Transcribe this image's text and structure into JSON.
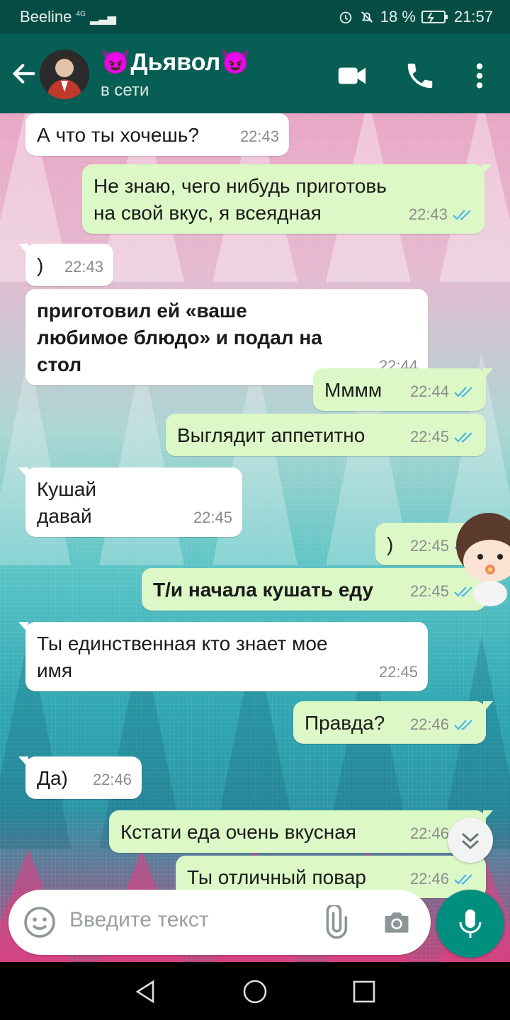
{
  "status_bar": {
    "carrier": "Beeline",
    "network": "4G",
    "battery": "18 %",
    "time": "21:57"
  },
  "header": {
    "name_emoji": "😈",
    "name": "Дьявол",
    "status": "в сети",
    "icons": [
      "back-arrow-icon",
      "video-call-icon",
      "voice-call-icon",
      "more-vert-icon"
    ]
  },
  "messages": [
    {
      "dir": "in",
      "text": "А что ты хочешь?",
      "time": "22:43",
      "tail": false
    },
    {
      "dir": "out",
      "text": "Не знаю, чего нибудь приготовь на свой вкус, я всеядная",
      "time": "22:43",
      "tail": true
    },
    {
      "dir": "in",
      "text": ")",
      "time": "22:43",
      "tail": true
    },
    {
      "dir": "in",
      "text": "приготовил ей «ваше любимое блюдо» и подал на стол",
      "time": "22:44",
      "tail": false,
      "bold": true
    },
    {
      "dir": "out",
      "text": "Мммм",
      "time": "22:44",
      "tail": true
    },
    {
      "dir": "out",
      "text": "Выглядит аппетитно",
      "time": "22:45",
      "tail": false
    },
    {
      "dir": "in",
      "text": "Кушай давай",
      "time": "22:45",
      "tail": true
    },
    {
      "dir": "out",
      "text": ")",
      "time": "22:45",
      "tail": true
    },
    {
      "dir": "out",
      "text": "Т/и начала кушать еду",
      "time": "22:45",
      "tail": false,
      "bold": true
    },
    {
      "dir": "in",
      "text": "Ты единственная кто знает мое имя",
      "time": "22:45",
      "tail": true
    },
    {
      "dir": "out",
      "text": "Правда?",
      "time": "22:46",
      "tail": true
    },
    {
      "dir": "in",
      "text": "Да)",
      "time": "22:46",
      "tail": true
    },
    {
      "dir": "out",
      "text": "Кстати еда очень вкусная",
      "time": "22:46",
      "tail": true
    },
    {
      "dir": "out",
      "text": "Ты отличный повар",
      "time": "22:46",
      "tail": false
    }
  ],
  "input": {
    "placeholder": "Введите текст"
  },
  "colors": {
    "header": "#075e54",
    "status_bar": "#054d44",
    "out_bubble": "#dcf8c6",
    "in_bubble": "#ffffff",
    "read_ticks": "#4fb6ec",
    "mic_button": "#008f7f"
  }
}
